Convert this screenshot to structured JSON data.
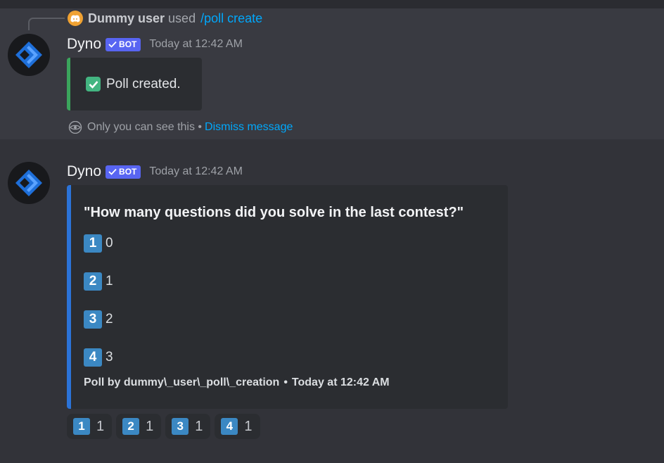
{
  "reply": {
    "user": "Dummy user",
    "used_text": "used",
    "command": "/poll create"
  },
  "message1": {
    "author": "Dyno",
    "badge": "BOT",
    "timestamp": "Today at 12:42 AM",
    "embed_text": "Poll created.",
    "ephemeral_text": "Only you can see this •",
    "dismiss_label": "Dismiss message"
  },
  "message2": {
    "author": "Dyno",
    "badge": "BOT",
    "timestamp": "Today at 12:42 AM",
    "poll": {
      "question": "\"How many questions did you solve in the last contest?\"",
      "options": [
        {
          "key": "1",
          "text": "0"
        },
        {
          "key": "2",
          "text": "1"
        },
        {
          "key": "3",
          "text": "2"
        },
        {
          "key": "4",
          "text": "3"
        }
      ],
      "footer_author": "Poll by dummy\\_user\\_poll\\_creation",
      "footer_sep": "•",
      "footer_time": "Today at 12:42 AM"
    },
    "reactions": [
      {
        "key": "1",
        "count": "1"
      },
      {
        "key": "2",
        "count": "1"
      },
      {
        "key": "3",
        "count": "1"
      },
      {
        "key": "4",
        "count": "1"
      }
    ]
  },
  "colors": {
    "background": "#323339",
    "highlight": "#393a41",
    "accent_link": "#00a8fc",
    "bot_badge": "#5865f2",
    "success_border": "#3ba55c",
    "poll_border": "#2b73d8",
    "keycap": "#3b88c3"
  },
  "icons": [
    "discord-icon",
    "dyno-avatar-icon",
    "checkmark-icon",
    "eye-icon",
    "keycap-icon"
  ]
}
